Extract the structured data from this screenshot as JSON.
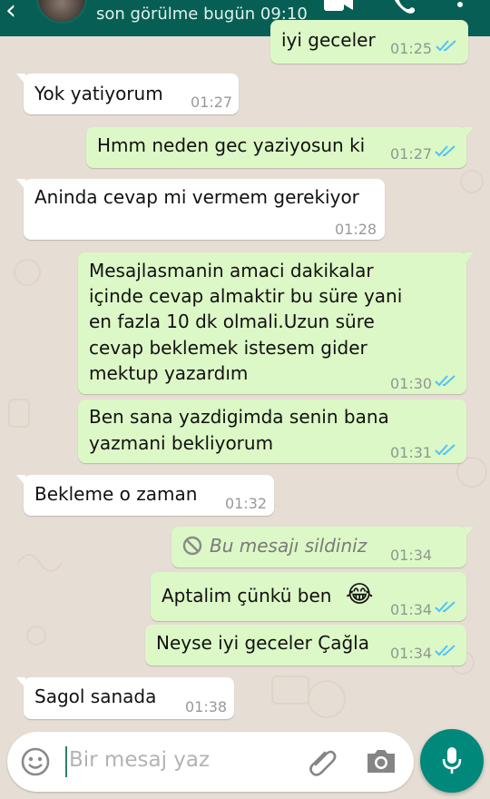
{
  "header": {
    "last_seen": "son görülme bugün 09:10"
  },
  "messages": [
    {
      "side": "out",
      "text": "iyi geceler",
      "time": "01:25",
      "ticks": "read"
    },
    {
      "side": "in",
      "text": "Yok yatiyorum",
      "time": "01:27"
    },
    {
      "side": "out",
      "text": "Hmm neden gec yaziyosun ki",
      "time": "01:27",
      "ticks": "read"
    },
    {
      "side": "in",
      "text": "Aninda cevap mi vermem gerekiyor",
      "time": "01:28"
    },
    {
      "side": "out",
      "lines": [
        "Mesajlasmanin amaci dakikalar",
        "içinde cevap almaktir bu süre yani",
        "en fazla 10 dk olmali.Uzun süre",
        "cevap beklemek istesem gider",
        "mektup yazardım"
      ],
      "time": "01:30",
      "ticks": "read"
    },
    {
      "side": "out",
      "lines": [
        "Ben sana yazdigimda senin bana",
        "yazmani bekliyorum"
      ],
      "time": "01:31",
      "ticks": "read"
    },
    {
      "side": "in",
      "text": "Bekleme o zaman",
      "time": "01:32"
    },
    {
      "side": "out",
      "text": "Bu mesajı sildiniz",
      "time": "01:34",
      "deleted": true
    },
    {
      "side": "out",
      "text": "Aptalim çünkü ben",
      "emoji": "😂",
      "time": "01:34",
      "ticks": "read"
    },
    {
      "side": "out",
      "text": "Neyse iyi geceler Çağla",
      "time": "01:34",
      "ticks": "read"
    },
    {
      "side": "in",
      "text": "Sagol sanada",
      "time": "01:38"
    }
  ],
  "composer": {
    "placeholder": "Bir mesaj yaz"
  },
  "colors": {
    "header": "#075e54",
    "outgoing_bubble": "#dcf8c6",
    "incoming_bubble": "#ffffff",
    "chat_background": "#e6ddd4",
    "read_ticks": "#4fc3f7",
    "mic_button": "#00897b"
  },
  "icons": [
    "back-arrow-icon",
    "video-call-icon",
    "phone-icon",
    "more-options-icon",
    "emoji-icon",
    "attach-icon",
    "camera-icon",
    "mic-icon",
    "blocked-icon",
    "double-check-icon"
  ]
}
